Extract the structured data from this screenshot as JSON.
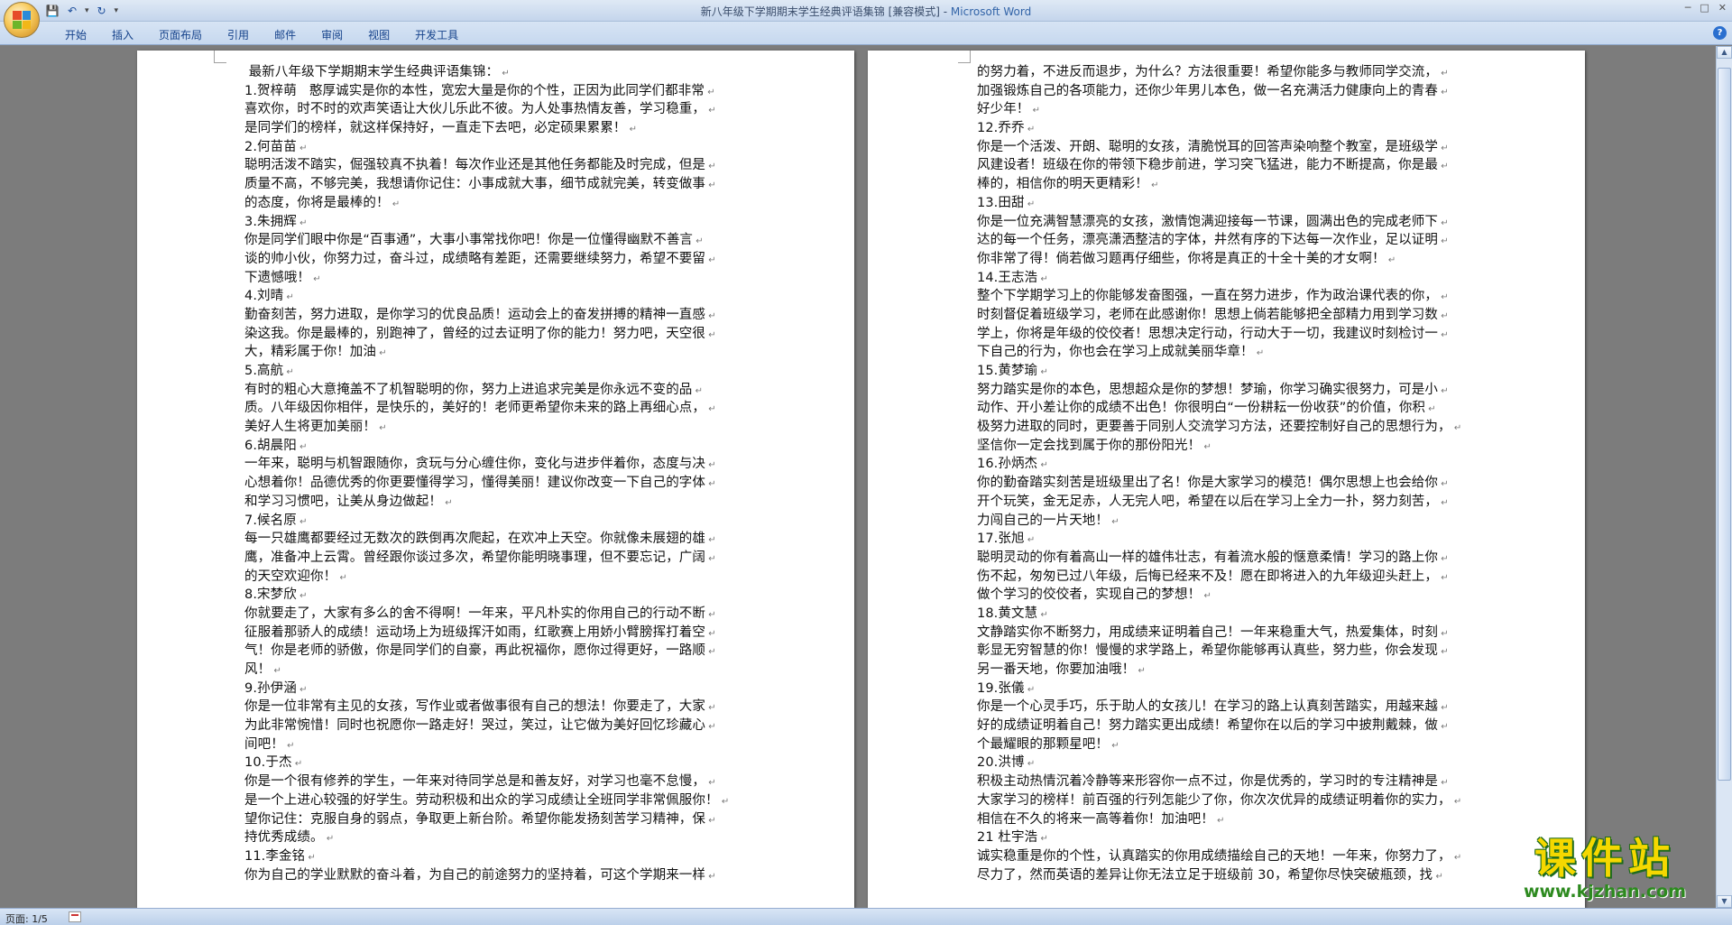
{
  "window": {
    "title_doc": "新八年级下学期期末学生经典评语集锦 [兼容模式] - ",
    "title_app": "Microsoft Word"
  },
  "ribbon": {
    "tabs": [
      "开始",
      "插入",
      "页面布局",
      "引用",
      "邮件",
      "审阅",
      "视图",
      "开发工具"
    ]
  },
  "document": {
    "left_page": [
      " 最新八年级下学期期末学生经典评语集锦：",
      "1.贺梓萌   憨厚诚实是你的本性，宽宏大量是你的个性，正因为此同学们都非常",
      "喜欢你，时不时的欢声笑语让大伙儿乐此不彼。为人处事热情友善，学习稳重，",
      "是同学们的榜样，就这样保持好，一直走下去吧，必定硕果累累！",
      "2.何苗苗",
      "聪明活泼不踏实，倔强较真不执着！每次作业还是其他任务都能及时完成，但是",
      "质量不高，不够完美，我想请你记住：小事成就大事，细节成就完美，转变做事",
      "的态度，你将是最棒的！",
      "3.朱拥辉",
      "你是同学们眼中你是“百事通”，大事小事常找你吧！你是一位懂得幽默不善言",
      "谈的帅小伙，你努力过，奋斗过，成绩略有差距，还需要继续努力，希望不要留",
      "下遗憾哦！",
      "4.刘晴",
      "勤奋刻苦，努力进取，是你学习的优良品质！运动会上的奋发拼搏的精神一直感",
      "染这我。你是最棒的，别跑神了，曾经的过去证明了你的能力！努力吧，天空很",
      "大，精彩属于你！加油",
      "5.高航",
      "有时的粗心大意掩盖不了机智聪明的你，努力上进追求完美是你永远不变的品",
      "质。八年级因你相伴，是快乐的，美好的！老师更希望你未来的路上再细心点，",
      "美好人生将更加美丽！",
      "6.胡晨阳",
      "一年来，聪明与机智跟随你，贪玩与分心缠住你，变化与进步伴着你，态度与决",
      "心想着你！品德优秀的你更要懂得学习，懂得美丽！建议你改变一下自己的字体",
      "和学习习惯吧，让美从身边做起！",
      "7.候名原",
      "每一只雄鹰都要经过无数次的跌倒再次爬起，在欢冲上天空。你就像未展翅的雄",
      "鹰，准备冲上云霄。曾经跟你谈过多次，希望你能明晓事理，但不要忘记，广阔",
      "的天空欢迎你！",
      "8.宋梦欣",
      "你就要走了，大家有多么的舍不得啊！一年来，平凡朴实的你用自己的行动不断",
      "征服着那骄人的成绩！运动场上为班级挥汗如雨，红歌赛上用娇小臂膀挥打着空",
      "气！你是老师的骄傲，你是同学们的自豪，再此祝福你，愿你过得更好，一路顺",
      "风！",
      "9.孙伊涵",
      "你是一位非常有主见的女孩，写作业或者做事很有自己的想法！你要走了，大家",
      "为此非常惋惜！同时也祝愿你一路走好！哭过，笑过，让它做为美好回忆珍藏心",
      "间吧！",
      "10.于杰",
      "你是一个很有修养的学生，一年来对待同学总是和善友好，对学习也毫不怠慢，",
      "是一个上进心较强的好学生。劳动积极和出众的学习成绩让全班同学非常佩服你！",
      "望你记住：克服自身的弱点，争取更上新台阶。希望你能发扬刻苦学习精神，保",
      "持优秀成绩。",
      "11.李金铭",
      "你为自己的学业默默的奋斗着，为自己的前途努力的坚持着，可这个学期来一样"
    ],
    "right_page": [
      "的努力着，不进反而退步，为什么？方法很重要！希望你能多与教师同学交流，",
      "加强锻炼自己的各项能力，还你少年男儿本色，做一名充满活力健康向上的青春",
      "好少年！",
      "12.乔乔",
      "你是一个活泼、开朗、聪明的女孩，清脆悦耳的回答声染响整个教室，是班级学",
      "风建设者！班级在你的带领下稳步前进，学习突飞猛进，能力不断提高，你是最",
      "棒的，相信你的明天更精彩！",
      "13.田甜",
      "你是一位充满智慧漂亮的女孩，激情饱满迎接每一节课，圆满出色的完成老师下",
      "达的每一个任务，漂亮潇洒整洁的字体，井然有序的下达每一次作业，足以证明",
      "你非常了得！倘若做习题再仔细些，你将是真正的十全十美的才女啊！",
      "14.王志浩",
      "整个下学期学习上的你能够发奋图强，一直在努力进步，作为政治课代表的你，",
      "时刻督促着班级学习，老师在此感谢你！思想上倘若能够把全部精力用到学习数",
      "学上，你将是年级的佼佼者！思想决定行动，行动大于一切，我建议时刻检讨一",
      "下自己的行为，你也会在学习上成就美丽华章！",
      "15.黄梦瑜",
      "努力踏实是你的本色，思想超众是你的梦想！梦瑜，你学习确实很努力，可是小",
      "动作、开小差让你的成绩不出色！你很明白“一份耕耘一份收获”的价值，你积",
      "极努力进取的同时，更要善于同别人交流学习方法，还要控制好自己的思想行为，",
      "坚信你一定会找到属于你的那份阳光！",
      "16.孙炳杰",
      "你的勤奋踏实刻苦是班级里出了名！你是大家学习的模范！偶尔思想上也会给你",
      "开个玩笑，金无足赤，人无完人吧，希望在以后在学习上全力一扑，努力刻苦，",
      "力闯自己的一片天地！",
      "17.张旭",
      "聪明灵动的你有着高山一样的雄伟壮志，有着流水般的惬意柔情！学习的路上你",
      "伤不起，匆匆已过八年级，后悔已经来不及！愿在即将进入的九年级迎头赶上，",
      "做个学习的佼佼者，实现自己的梦想！",
      "18.黄文慧",
      "文静踏实你不断努力，用成绩来证明着自己！一年来稳重大气，热爱集体，时刻",
      "彰显无穷智慧的你！慢慢的求学路上，希望你能够再认真些，努力些，你会发现",
      "另一番天地，你要加油哦！",
      "19.张儀",
      "你是一个心灵手巧，乐于助人的女孩儿！在学习的路上认真刻苦踏实，用越来越",
      "好的成绩证明着自己！努力踏实更出成绩！希望你在以后的学习中披荆戴棘，做",
      "个最耀眼的那颗星吧！",
      "20.洪博",
      "积极主动热情沉着冷静等来形容你一点不过，你是优秀的，学习时的专注精神是",
      "大家学习的榜样！前百强的行列怎能少了你，你次次优异的成绩证明着你的实力，",
      "相信在不久的将来一高等着你！加油吧！",
      "21 杜宇浩",
      "诚实稳重是你的个性，认真踏实的你用成绩描绘自己的天地！一年来，你努力了，",
      "尽力了，然而英语的差异让你无法立足于班级前 30，希望你尽快突破瓶颈，找"
    ]
  },
  "statusbar": {
    "page_info": "页面: 1/5"
  },
  "watermark": {
    "title": "课件站",
    "url": "www.kjzhan.com"
  },
  "colors": {
    "accent": "#15428b",
    "watermark_yellow": "#f5d800",
    "watermark_green": "#2d8a1f"
  }
}
